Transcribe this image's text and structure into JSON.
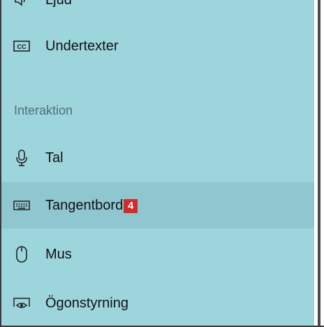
{
  "menu": {
    "items": [
      {
        "label": "Ljud",
        "icon": "speaker-icon"
      },
      {
        "label": "Undertexter",
        "icon": "closed-captions-icon"
      }
    ],
    "section_heading": "Interaktion",
    "interaction_items": [
      {
        "label": "Tal",
        "icon": "microphone-icon"
      },
      {
        "label": "Tangentbord",
        "icon": "keyboard-icon",
        "badge": "4",
        "selected": true
      },
      {
        "label": "Mus",
        "icon": "mouse-icon"
      },
      {
        "label": "Ögonstyrning",
        "icon": "eye-control-icon"
      }
    ]
  },
  "colors": {
    "panel_background": "#9dd5dd",
    "selected_background": "#8fc7d0",
    "badge_background": "#d42a2a"
  }
}
